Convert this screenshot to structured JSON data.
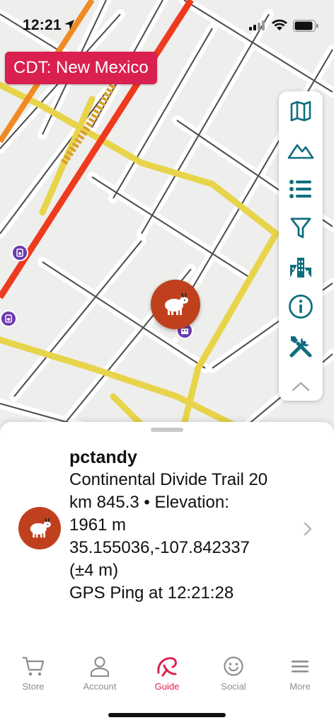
{
  "status_bar": {
    "time": "12:21"
  },
  "map": {
    "region_label": "CDT: New Mexico"
  },
  "toolbar": {
    "tools": [
      {
        "icon": "map-icon"
      },
      {
        "icon": "mountain-icon"
      },
      {
        "icon": "list-icon"
      },
      {
        "icon": "filter-icon"
      },
      {
        "icon": "city-icon"
      },
      {
        "icon": "info-icon"
      },
      {
        "icon": "tools-icon"
      },
      {
        "icon": "chevron-up-icon"
      }
    ]
  },
  "sheet": {
    "name": "pctandy",
    "lines": [
      "Continental Divide Trail 20",
      "km 845.3 • Elevation:",
      "1961 m",
      "35.155036,-107.842337",
      "(±4 m)",
      "GPS Ping at 12:21:28"
    ]
  },
  "tabbar": {
    "tabs": [
      {
        "label": "Store",
        "icon": "cart-icon",
        "active": false
      },
      {
        "label": "Account",
        "icon": "person-icon",
        "active": false
      },
      {
        "label": "Guide",
        "icon": "guide-icon",
        "active": true
      },
      {
        "label": "Social",
        "icon": "smiley-icon",
        "active": false
      },
      {
        "label": "More",
        "icon": "menu-icon",
        "active": false
      }
    ]
  },
  "colors": {
    "accent": "#d9204f",
    "teal": "#0f6e7e",
    "marker": "#c0401e",
    "poi": "#6c3ab0"
  }
}
